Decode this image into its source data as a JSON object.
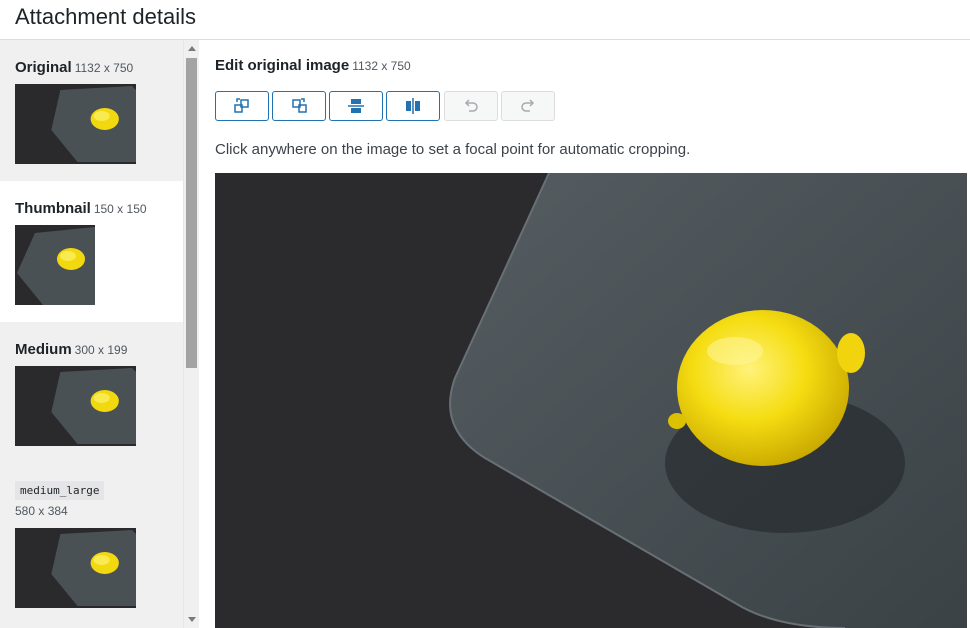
{
  "header": {
    "title": "Attachment details"
  },
  "sizes": [
    {
      "name": "Original",
      "dims": "1132 x 750"
    },
    {
      "name": "Thumbnail",
      "dims": "150 x 150"
    },
    {
      "name": "Medium",
      "dims": "300 x 199"
    },
    {
      "name": "medium_large",
      "dims": "580 x 384"
    }
  ],
  "editor": {
    "title": "Edit original image",
    "dims": "1132 x 750",
    "hint": "Click anywhere on the image to set a focal point for automatic cropping."
  },
  "toolbar": {
    "buttons": [
      {
        "icon": "rotate-left-icon",
        "enabled": true
      },
      {
        "icon": "rotate-right-icon",
        "enabled": true
      },
      {
        "icon": "flip-vertical-icon",
        "enabled": true
      },
      {
        "icon": "flip-horizontal-icon",
        "enabled": true
      },
      {
        "icon": "undo-icon",
        "enabled": false
      },
      {
        "icon": "redo-icon",
        "enabled": false
      }
    ]
  },
  "colors": {
    "accent": "#2271b1",
    "disabled": "#a7aaad"
  }
}
